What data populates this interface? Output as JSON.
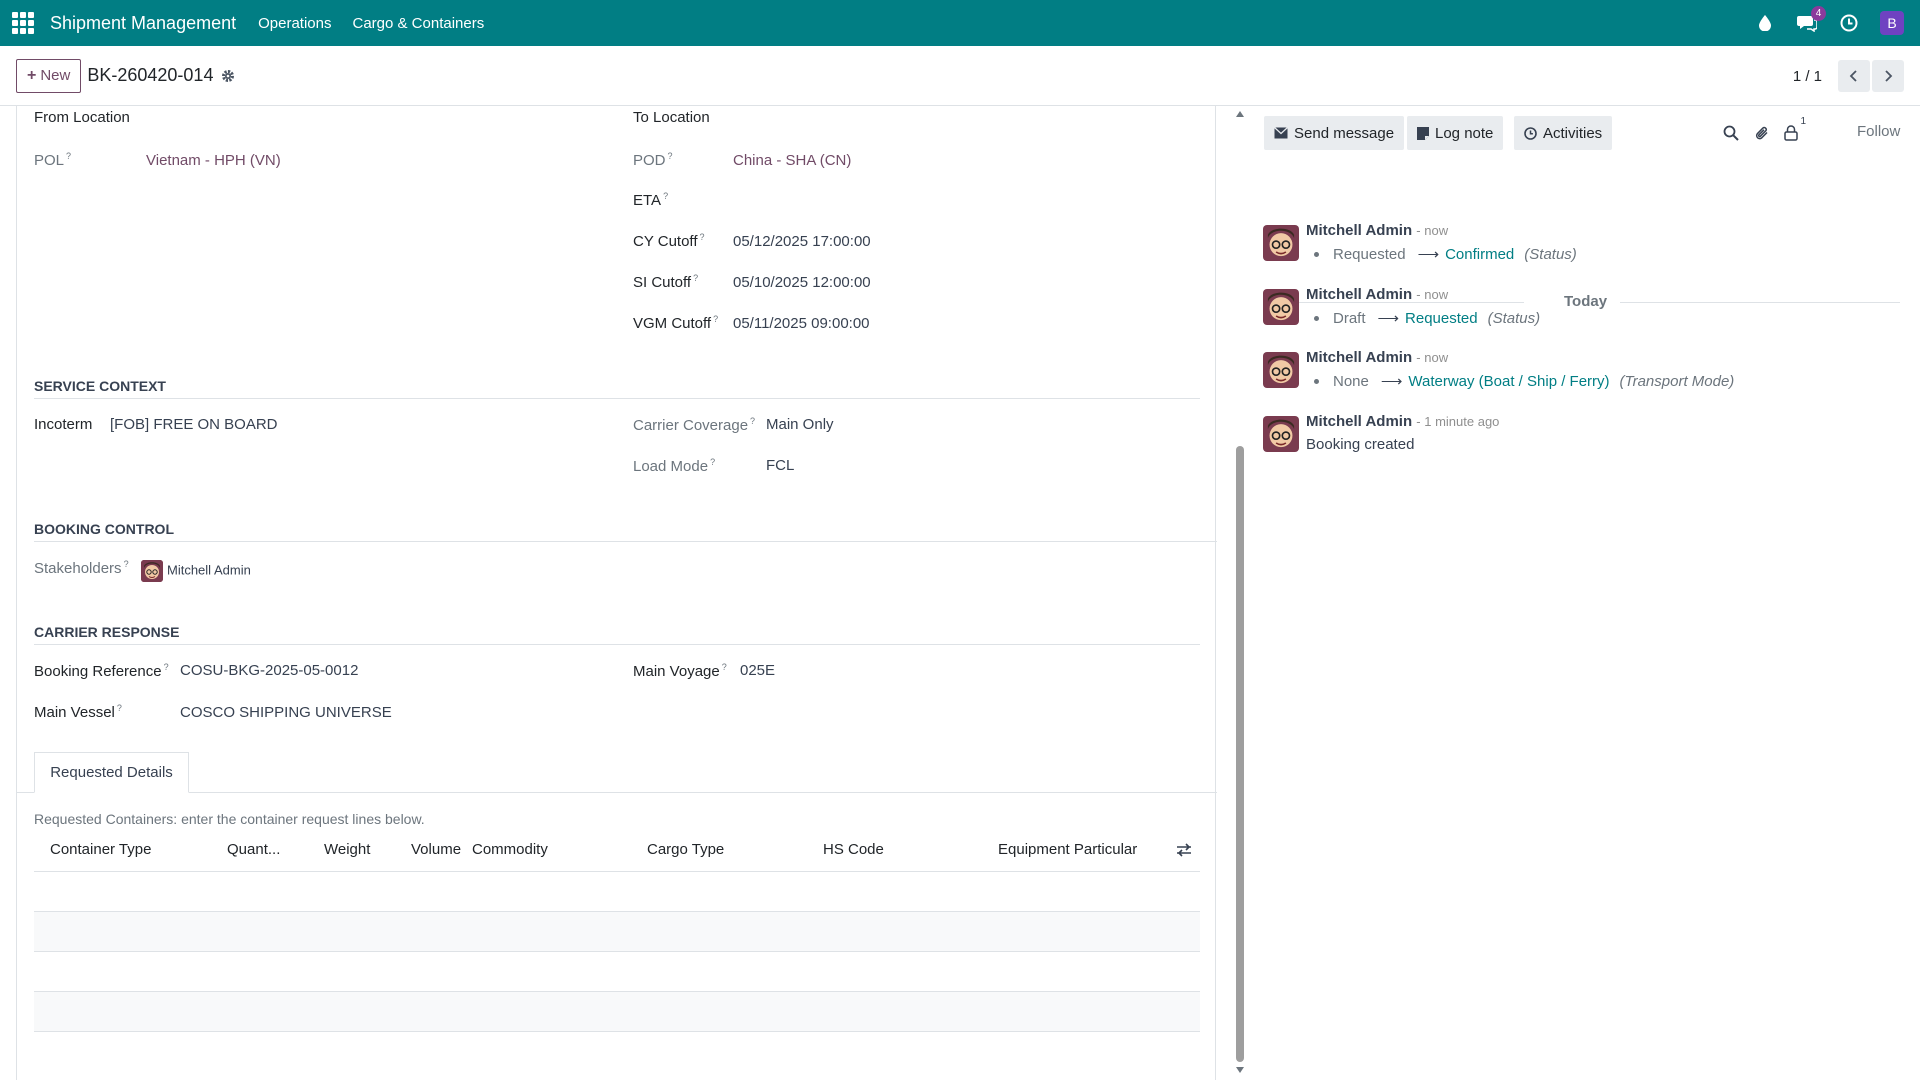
{
  "navbar": {
    "app_name": "Shipment Management",
    "menus": [
      "Operations",
      "Cargo & Containers"
    ],
    "messages_badge": "4",
    "user_initial": "B"
  },
  "control_panel": {
    "new_label": "New",
    "record_title": "BK-260420-014",
    "pager": "1 / 1"
  },
  "form": {
    "from_location_header": "From Location",
    "to_location_header": "To Location",
    "pol_label": "POL",
    "pol_value": "Vietnam - HPH (VN)",
    "pod_label": "POD",
    "pod_value": "China - SHA (CN)",
    "eta_label": "ETA",
    "cy_cutoff_label": "CY Cutoff",
    "cy_cutoff_value": "05/12/2025 17:00:00",
    "si_cutoff_label": "SI Cutoff",
    "si_cutoff_value": "05/10/2025 12:00:00",
    "vgm_cutoff_label": "VGM Cutoff",
    "vgm_cutoff_value": "05/11/2025 09:00:00",
    "help_mark": "?",
    "service_context_title": "SERVICE CONTEXT",
    "incoterm_label": "Incoterm",
    "incoterm_value": "[FOB] FREE ON BOARD",
    "carrier_coverage_label": "Carrier Coverage",
    "carrier_coverage_value": "Main Only",
    "load_mode_label": "Load Mode",
    "load_mode_value": "FCL",
    "booking_control_title": "BOOKING CONTROL",
    "stakeholders_label": "Stakeholders",
    "stakeholder_name": "Mitchell Admin",
    "carrier_response_title": "CARRIER RESPONSE",
    "booking_ref_label": "Booking Reference",
    "booking_ref_value": "COSU-BKG-2025-05-0012",
    "main_voyage_label": "Main Voyage",
    "main_voyage_value": "025E",
    "main_vessel_label": "Main Vessel",
    "main_vessel_value": "COSCO SHIPPING UNIVERSE"
  },
  "tabs": {
    "requested_details": "Requested Details"
  },
  "requested_table": {
    "hint": "Requested Containers: enter the container request lines below.",
    "columns": [
      "Container Type",
      "Quant...",
      "Weight",
      "Volume",
      "Commodity",
      "Cargo Type",
      "HS Code",
      "Equipment Particular"
    ]
  },
  "chatter": {
    "send_message": "Send message",
    "log_note": "Log note",
    "activities": "Activities",
    "followers_count": "1",
    "follow": "Follow",
    "today": "Today",
    "messages": [
      {
        "author": "Mitchell Admin",
        "date": "- now",
        "old": "Requested",
        "new": "Confirmed",
        "field": "(Status)"
      },
      {
        "author": "Mitchell Admin",
        "date": "- now",
        "old": "Draft",
        "new": "Requested",
        "field": "(Status)"
      },
      {
        "author": "Mitchell Admin",
        "date": "- now",
        "old": "None",
        "new": "Waterway (Boat / Ship / Ferry)",
        "field": "(Transport Mode)"
      },
      {
        "author": "Mitchell Admin",
        "date": "- 1 minute ago",
        "body": "Booking created"
      }
    ]
  }
}
